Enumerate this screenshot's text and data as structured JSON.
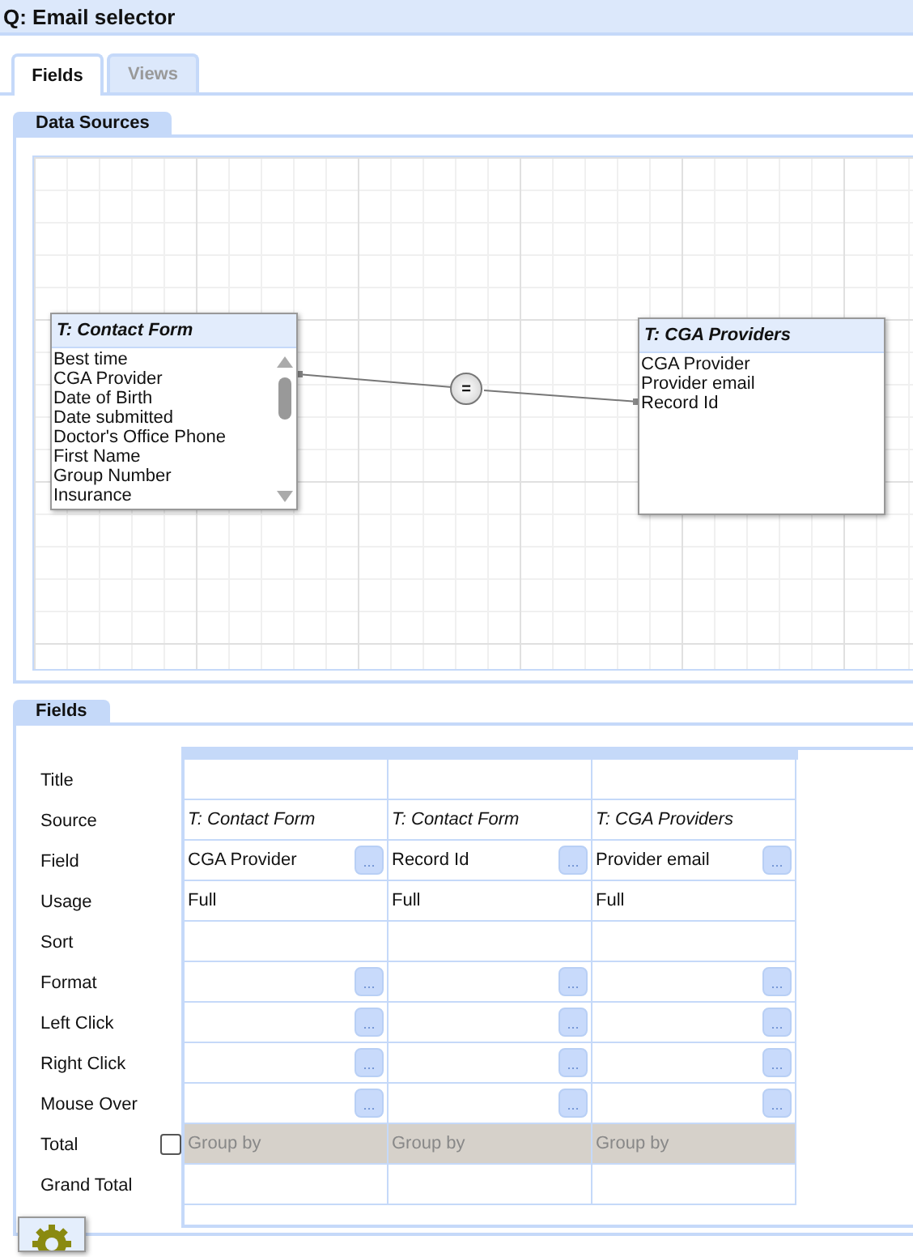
{
  "window": {
    "title": "Q: Email selector"
  },
  "tabs": [
    {
      "label": "Fields",
      "selected": true
    },
    {
      "label": "Views",
      "selected": false
    }
  ],
  "data_sources": {
    "title": "Data Sources",
    "tables": [
      {
        "title": "T: Contact Form",
        "scrollable": true,
        "fields": [
          "Best time",
          "CGA Provider",
          "Date of Birth",
          "Date submitted",
          "Doctor's Office Phone",
          "First Name",
          "Group Number",
          "Insurance"
        ]
      },
      {
        "title": "T: CGA Providers",
        "scrollable": false,
        "fields": [
          "CGA Provider",
          "Provider email",
          "Record Id"
        ]
      }
    ],
    "join": {
      "operator": "="
    }
  },
  "fields": {
    "title": "Fields",
    "rows": [
      {
        "label": "Title",
        "kind": "text",
        "cells": [
          {},
          {},
          {}
        ]
      },
      {
        "label": "Source",
        "kind": "source",
        "cells": [
          {
            "value": "T: Contact Form"
          },
          {
            "value": "T: Contact Form"
          },
          {
            "value": "T: CGA Providers"
          }
        ]
      },
      {
        "label": "Field",
        "kind": "text",
        "cells": [
          {
            "value": "CGA Provider",
            "button": "..."
          },
          {
            "value": "Record Id",
            "button": "..."
          },
          {
            "value": "Provider email",
            "button": "..."
          }
        ]
      },
      {
        "label": "Usage",
        "kind": "text",
        "cells": [
          {
            "value": "Full"
          },
          {
            "value": "Full"
          },
          {
            "value": "Full"
          }
        ]
      },
      {
        "label": "Sort",
        "kind": "text",
        "cells": [
          {},
          {},
          {}
        ]
      },
      {
        "label": "Format",
        "kind": "text",
        "cells": [
          {
            "button": "..."
          },
          {
            "button": "..."
          },
          {
            "button": "..."
          }
        ]
      },
      {
        "label": "Left Click",
        "kind": "text",
        "cells": [
          {
            "button": "..."
          },
          {
            "button": "..."
          },
          {
            "button": "..."
          }
        ]
      },
      {
        "label": "Right Click",
        "kind": "text",
        "cells": [
          {
            "button": "..."
          },
          {
            "button": "..."
          },
          {
            "button": "..."
          }
        ]
      },
      {
        "label": "Mouse Over",
        "kind": "text",
        "cells": [
          {
            "button": "..."
          },
          {
            "button": "..."
          },
          {
            "button": "..."
          }
        ]
      },
      {
        "label": "Total",
        "kind": "group",
        "checked": false,
        "cells": [
          {
            "placeholder": "Group by"
          },
          {
            "placeholder": "Group by"
          },
          {
            "placeholder": "Group by"
          }
        ]
      },
      {
        "label": "Grand Total",
        "kind": "text",
        "cells": [
          {},
          {},
          {}
        ]
      }
    ]
  }
}
